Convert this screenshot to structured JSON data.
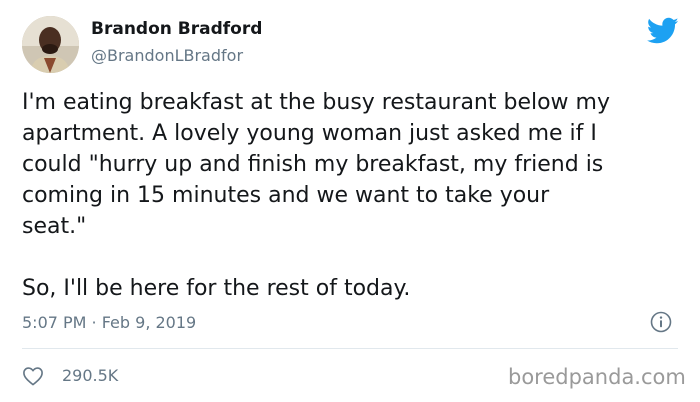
{
  "author": {
    "display_name": "Brandon Bradford",
    "handle": "@BrandonLBradfor",
    "avatar": "profile-photo"
  },
  "tweet": {
    "lines": [
      "I'm eating breakfast at the busy restaurant below my",
      "apartment.  A lovely young woman just asked me if I",
      "could \"hurry up and finish my breakfast, my friend is",
      "coming in 15 minutes and we want to take your",
      "seat.\""
    ],
    "closing": "So, I'll be here for the rest of today.",
    "timestamp": "5:07 PM · Feb 9, 2019"
  },
  "engagement": {
    "likes": "290.5K"
  },
  "watermark": "boredpanda.com",
  "icons": {
    "brand": "twitter-bird-icon",
    "info": "info-icon",
    "like": "heart-icon"
  },
  "colors": {
    "twitter_blue": "#1da1f2",
    "text": "#14171a",
    "secondary_text": "#657786",
    "divider": "#e1e8ed"
  }
}
